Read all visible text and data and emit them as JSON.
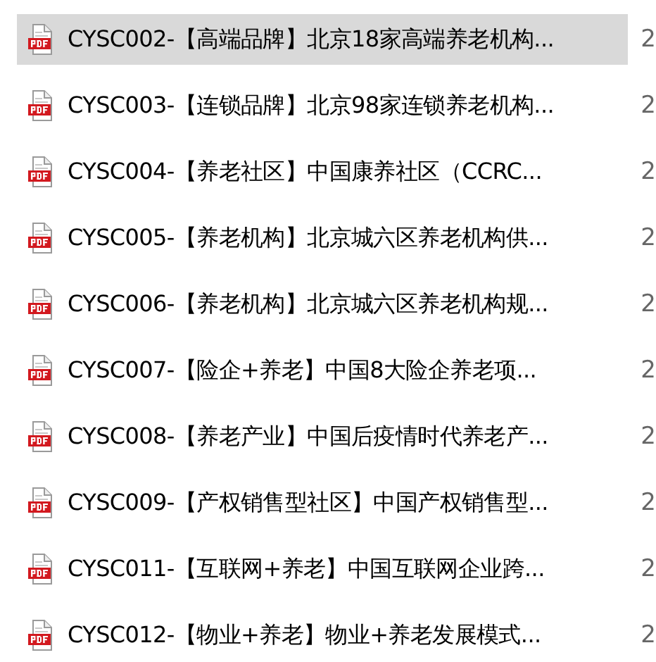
{
  "files": [
    {
      "name": "CYSC002-【高端品牌】北京18家高端养老机构...",
      "column_2": "2",
      "selected": true
    },
    {
      "name": "CYSC003-【连锁品牌】北京98家连锁养老机构...",
      "column_2": "2",
      "selected": false
    },
    {
      "name": "CYSC004-【养老社区】中国康养社区（CCRC...",
      "column_2": "2",
      "selected": false
    },
    {
      "name": "CYSC005-【养老机构】北京城六区养老机构供...",
      "column_2": "2",
      "selected": false
    },
    {
      "name": "CYSC006-【养老机构】北京城六区养老机构规...",
      "column_2": "2",
      "selected": false
    },
    {
      "name": "CYSC007-【险企+养老】中国8大险企养老项...",
      "column_2": "2",
      "selected": false
    },
    {
      "name": "CYSC008-【养老产业】中国后疫情时代养老产...",
      "column_2": "2",
      "selected": false
    },
    {
      "name": "CYSC009-【产权销售型社区】中国产权销售型...",
      "column_2": "2",
      "selected": false
    },
    {
      "name": "CYSC011-【互联网+养老】中国互联网企业跨...",
      "column_2": "2",
      "selected": false
    },
    {
      "name": "CYSC012-【物业+养老】物业+养老发展模式...",
      "column_2": "2",
      "selected": false
    }
  ]
}
